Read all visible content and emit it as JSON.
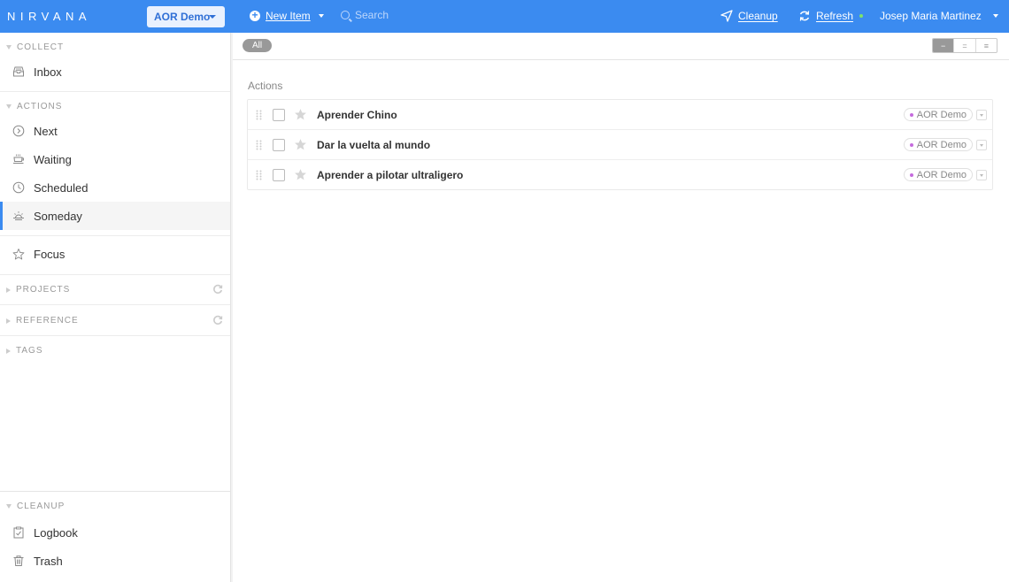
{
  "topbar": {
    "logo": "NIRVANA",
    "area": "AOR Demo",
    "new_item": "New Item",
    "search_placeholder": "Search",
    "cleanup": "Cleanup",
    "refresh": "Refresh",
    "user": "Josep Maria Martinez"
  },
  "sidebar": {
    "collect": {
      "heading": "COLLECT",
      "items": [
        {
          "label": "Inbox",
          "icon": "inbox-icon"
        }
      ]
    },
    "actions": {
      "heading": "ACTIONS",
      "items": [
        {
          "label": "Next",
          "icon": "next-icon"
        },
        {
          "label": "Waiting",
          "icon": "waiting-icon"
        },
        {
          "label": "Scheduled",
          "icon": "clock-icon"
        },
        {
          "label": "Someday",
          "icon": "sunrise-icon",
          "active": true
        }
      ]
    },
    "focus": {
      "label": "Focus",
      "icon": "star-icon"
    },
    "projects": {
      "heading": "PROJECTS"
    },
    "reference": {
      "heading": "REFERENCE"
    },
    "tags": {
      "heading": "TAGS"
    },
    "cleanup": {
      "heading": "CLEANUP",
      "items": [
        {
          "label": "Logbook",
          "icon": "logbook-icon"
        },
        {
          "label": "Trash",
          "icon": "trash-icon"
        }
      ]
    }
  },
  "filter": {
    "all_label": "All",
    "view_modes": [
      "−",
      "=",
      "≡"
    ],
    "selected_view": 0
  },
  "main": {
    "group_title": "Actions",
    "tasks": [
      {
        "name": "Aprender Chino",
        "tag": "AOR Demo"
      },
      {
        "name": "Dar la vuelta al mundo",
        "tag": "AOR Demo"
      },
      {
        "name": "Aprender a pilotar ultraligero",
        "tag": "AOR Demo"
      }
    ]
  },
  "colors": {
    "accent": "#3b8bf0",
    "tag_dot": "#c56bdd",
    "refresh_dot": "#7ee36a"
  }
}
